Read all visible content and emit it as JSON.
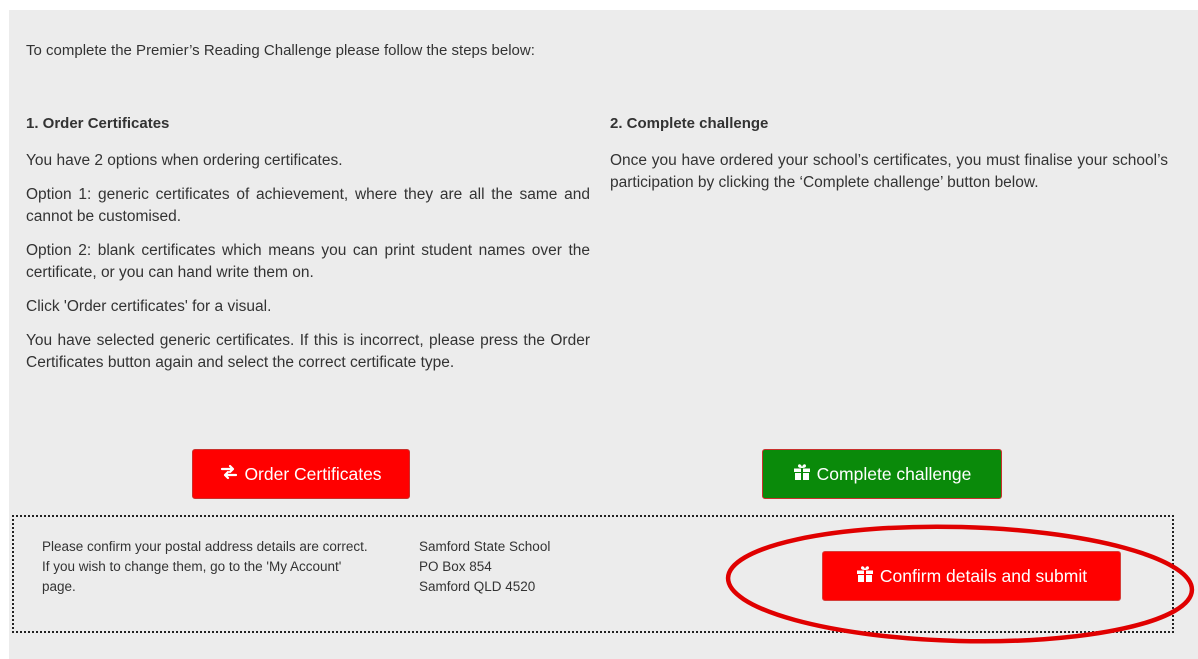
{
  "intro_text": "To complete the Premier’s Reading Challenge please follow the steps below:",
  "step1": {
    "heading": "1. Order Certificates",
    "paragraphs": [
      "You have 2 options when ordering certificates.",
      "Option 1: generic certificates of achievement, where they are all the same and cannot be customised.",
      "Option 2: blank certificates which means you can print student names over the certificate, or you can hand write them on.",
      "Click 'Order certificates' for a visual.",
      "You have selected generic certificates. If this is incorrect, please press the Order Certificates button again and select the correct certificate type."
    ],
    "button_label": "Order Certificates",
    "button_icon": "exchange-arrows-icon"
  },
  "step2": {
    "heading": "2. Complete challenge",
    "paragraphs": [
      "Once you have ordered your school’s certificates, you must finalise your school’s participation by clicking the ‘Complete challenge’ button below."
    ],
    "button_label": "Complete challenge",
    "button_icon": "gift-icon"
  },
  "confirm": {
    "text": "Please confirm your postal address details are correct. If you wish to change them, go to the 'My Account' page.",
    "address": {
      "line1": "Samford State School",
      "line2": "PO Box 854",
      "line3": "Samford QLD 4520"
    },
    "button_label": "Confirm details and submit",
    "button_icon": "gift-icon"
  },
  "colors": {
    "panel_bg": "#ececec",
    "red_button": "#ff0000",
    "green_button": "#0a8a0a",
    "annotation_red": "#e00000"
  }
}
